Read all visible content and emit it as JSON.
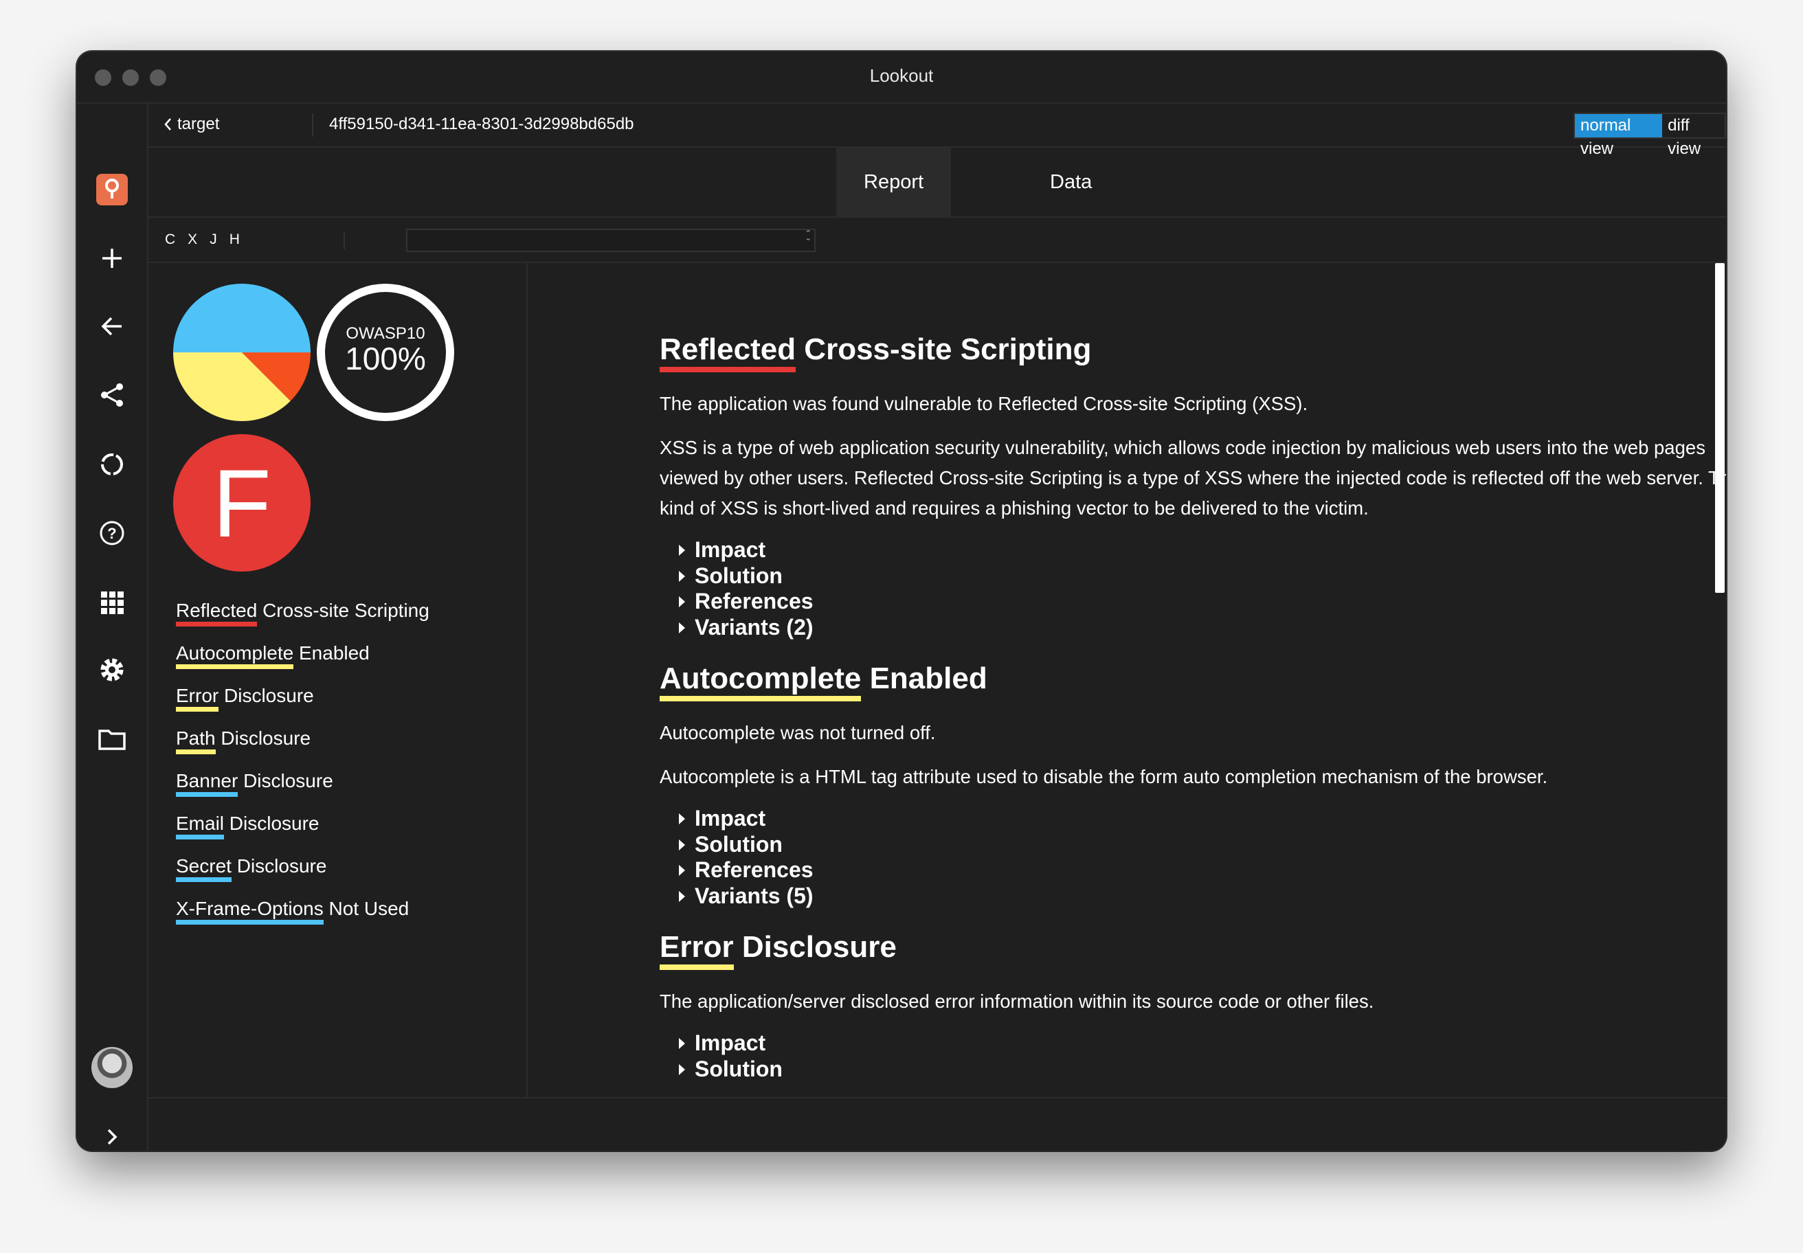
{
  "window": {
    "title": "Lookout"
  },
  "header": {
    "back_label": "target",
    "run_id": "4ff59150-d341-11ea-8301-3d2998bd65db",
    "normal_view": "normal view",
    "diff_view": "diff view"
  },
  "tabs": [
    {
      "label": "Report",
      "active": true
    },
    {
      "label": "Data",
      "active": false
    }
  ],
  "toolbar": {
    "keys": [
      "C",
      "X",
      "J",
      "H"
    ],
    "select_value": ""
  },
  "colors": {
    "high": "#e53935",
    "medium": "#fff176",
    "low": "#4fc3f7",
    "pie_red": "#f4511e",
    "accent": "#2290d6",
    "logo": "#e8704a"
  },
  "severity_pie": [
    {
      "level": "low",
      "value": 4
    },
    {
      "level": "high",
      "value": 1
    },
    {
      "level": "medium",
      "value": 3
    }
  ],
  "owasp": {
    "label": "OWASP10",
    "value": "100%"
  },
  "grade": "F",
  "findings": [
    {
      "u": "Reflected",
      "rest": " Cross-site Scripting",
      "severity": "high"
    },
    {
      "u": "Autocomplete",
      "rest": " Enabled",
      "severity": "medium"
    },
    {
      "u": "Error",
      "rest": " Disclosure",
      "severity": "medium"
    },
    {
      "u": "Path",
      "rest": " Disclosure",
      "severity": "medium"
    },
    {
      "u": "Banner",
      "rest": " Disclosure",
      "severity": "low"
    },
    {
      "u": "Email",
      "rest": " Disclosure",
      "severity": "low"
    },
    {
      "u": "Secret",
      "rest": " Disclosure",
      "severity": "low"
    },
    {
      "u": "X-Frame-Options",
      "rest": " Not Used",
      "severity": "low"
    }
  ],
  "sections": [
    {
      "u": "Reflected",
      "rest": " Cross-site Scripting",
      "severity": "high",
      "p1": "The application was found vulnerable to Reflected Cross-site Scripting (XSS).",
      "p2": "XSS is a type of web application security vulnerability, which allows code injection by malicious web users into the web pages viewed by other users. Reflected Cross-site Scripting is a type of XSS where the injected code is reflected off the web server. This kind of XSS is short-lived and requires a phishing vector to be delivered to the victim.",
      "details": [
        "Impact",
        "Solution",
        "References",
        "Variants (2)"
      ]
    },
    {
      "u": "Autocomplete",
      "rest": " Enabled",
      "severity": "medium",
      "p1": "Autocomplete was not turned off.",
      "p2": "Autocomplete is a HTML tag attribute used to disable the form auto completion mechanism of the browser.",
      "details": [
        "Impact",
        "Solution",
        "References",
        "Variants (5)"
      ]
    },
    {
      "u": "Error",
      "rest": " Disclosure",
      "severity": "medium",
      "p1": "The application/server disclosed error information within its source code or other files.",
      "details": [
        "Impact",
        "Solution"
      ]
    }
  ]
}
